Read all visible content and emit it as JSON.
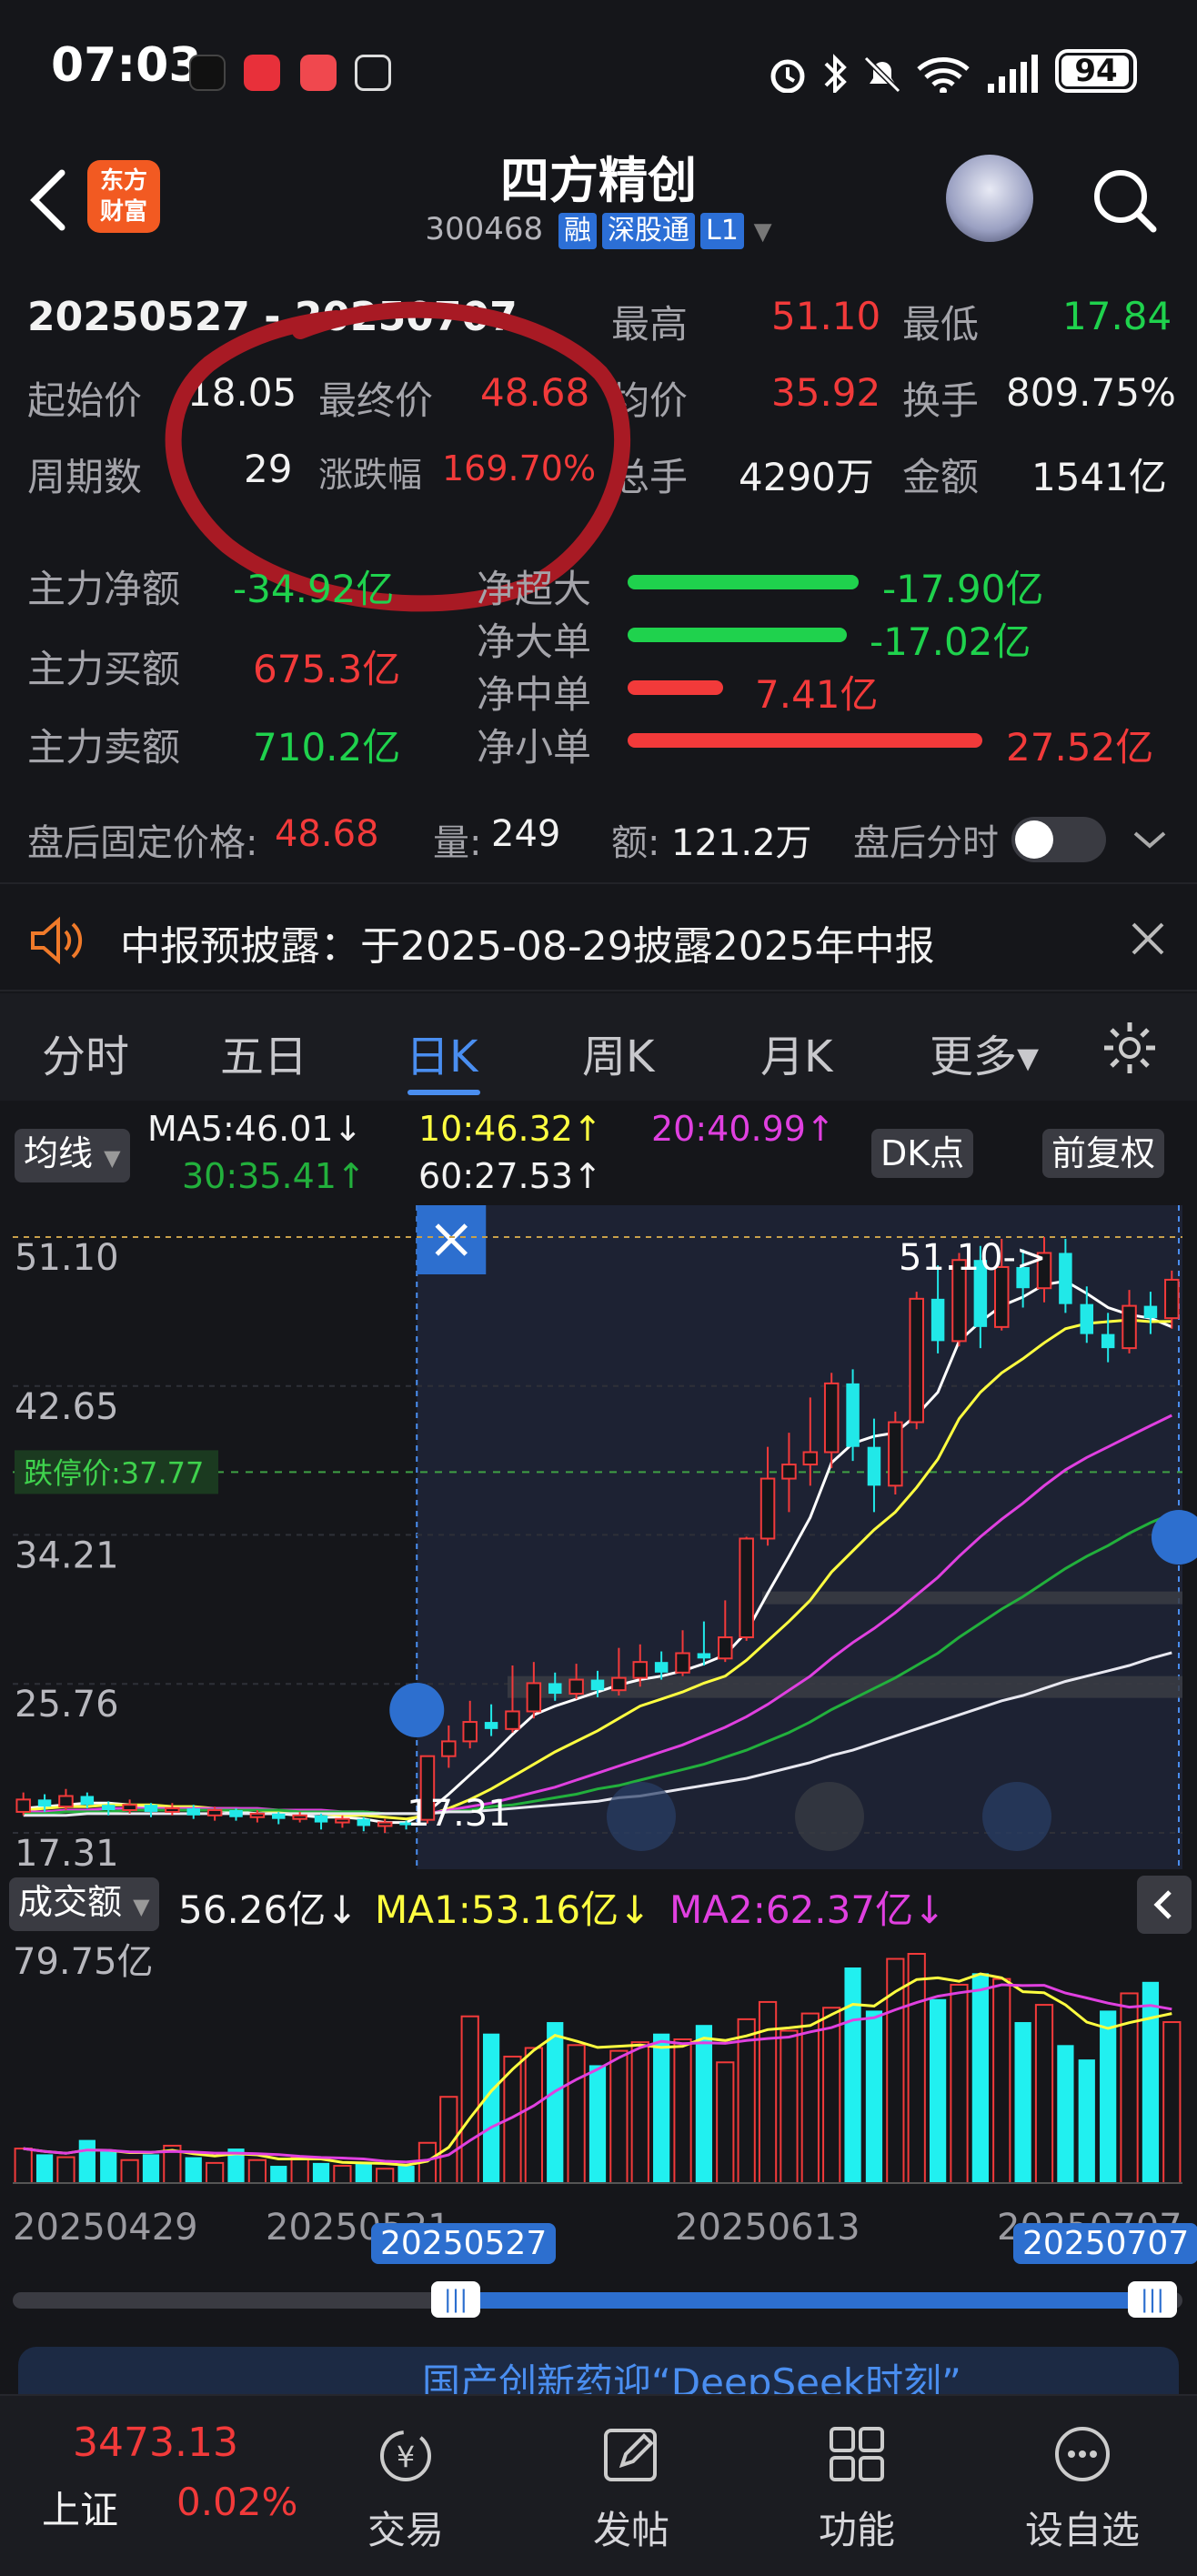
{
  "status_bar": {
    "time": "07:03",
    "battery": "94"
  },
  "header": {
    "logo_text": "东方财富",
    "stock_name": "四方精创",
    "stock_code": "300468",
    "tags": [
      "融",
      "深股通",
      "L1"
    ]
  },
  "summary": {
    "date_range": "20250527 - 20250707",
    "high_label": "最高",
    "high_value": "51.10",
    "low_label": "最低",
    "low_value": "17.84",
    "start_label": "起始价",
    "start_value": "18.05",
    "final_label": "最终价",
    "final_value": "48.68",
    "avg_label": "均价",
    "avg_value": "35.92",
    "turnover_label": "换手",
    "turnover_value": "809.75%",
    "period_label": "周期数",
    "period_value": "29",
    "change_label": "涨跌幅",
    "change_value": "169.70%",
    "volume_label": "总手",
    "volume_value": "4290万",
    "amount_label": "金额",
    "amount_value": "1541亿"
  },
  "funds": {
    "net_label": "主力净额",
    "net_value": "-34.92亿",
    "buy_label": "主力买额",
    "buy_value": "675.3亿",
    "sell_label": "主力卖额",
    "sell_value": "710.2亿",
    "bars": [
      {
        "label": "净超大",
        "value": "-17.90亿",
        "color": "#1fd24d",
        "magnitude": 17.9
      },
      {
        "label": "净大单",
        "value": "-17.02亿",
        "color": "#1fd24d",
        "magnitude": 17.02
      },
      {
        "label": "净中单",
        "value": "7.41亿",
        "color": "#f23a3a",
        "magnitude": 7.41
      },
      {
        "label": "净小单",
        "value": "27.52亿",
        "color": "#f23a3a",
        "magnitude": 27.52
      }
    ]
  },
  "after_hours": {
    "price_label": "盘后固定价格:",
    "price_value": "48.68",
    "vol_label": "量:",
    "vol_value": "249",
    "amt_label": "额:",
    "amt_value": "121.2万",
    "timeshare_label": "盘后分时"
  },
  "notice": {
    "text": "中报预披露：于2025-08-29披露2025年中报"
  },
  "tabs": [
    {
      "label": "分时"
    },
    {
      "label": "五日"
    },
    {
      "label": "日K"
    },
    {
      "label": "周K"
    },
    {
      "label": "月K"
    },
    {
      "label": "更多▾"
    }
  ],
  "indicators": {
    "ma_button": "均线",
    "ma5": "MA5:46.01↓",
    "ma10": "10:46.32↑",
    "ma20": "20:40.99↑",
    "ma30": "30:35.41↑",
    "ma60": "60:27.53↑",
    "dk_button": "DK点",
    "adjust_button": "前复权"
  },
  "chart_data": [
    {
      "type": "candlestick",
      "y_ticks": [
        "51.10",
        "42.65",
        "34.21",
        "25.76",
        "17.31"
      ],
      "limit_label": "跌停价:37.77",
      "limit_value": 37.77,
      "high_marker": "51.10->",
      "low_marker": "17.31",
      "ylim": [
        17.31,
        51.1
      ],
      "selection_start_index": 19,
      "candles": [
        {
          "o": 18.5,
          "c": 19.2,
          "h": 19.6,
          "l": 18.3
        },
        {
          "o": 19.2,
          "c": 18.8,
          "h": 19.5,
          "l": 18.5
        },
        {
          "o": 18.8,
          "c": 19.4,
          "h": 19.8,
          "l": 18.6
        },
        {
          "o": 19.4,
          "c": 18.9,
          "h": 19.6,
          "l": 18.7
        },
        {
          "o": 18.9,
          "c": 18.6,
          "h": 19.1,
          "l": 18.3
        },
        {
          "o": 18.6,
          "c": 18.9,
          "h": 19.2,
          "l": 18.4
        },
        {
          "o": 18.9,
          "c": 18.5,
          "h": 19.0,
          "l": 18.2
        },
        {
          "o": 18.5,
          "c": 18.7,
          "h": 19.0,
          "l": 18.3
        },
        {
          "o": 18.7,
          "c": 18.3,
          "h": 18.9,
          "l": 18.1
        },
        {
          "o": 18.3,
          "c": 18.6,
          "h": 18.8,
          "l": 18.0
        },
        {
          "o": 18.6,
          "c": 18.2,
          "h": 18.7,
          "l": 18.0
        },
        {
          "o": 18.2,
          "c": 18.4,
          "h": 18.6,
          "l": 17.9
        },
        {
          "o": 18.4,
          "c": 18.1,
          "h": 18.5,
          "l": 17.8
        },
        {
          "o": 18.1,
          "c": 18.3,
          "h": 18.5,
          "l": 17.9
        },
        {
          "o": 18.3,
          "c": 17.9,
          "h": 18.4,
          "l": 17.5
        },
        {
          "o": 17.9,
          "c": 18.1,
          "h": 18.3,
          "l": 17.6
        },
        {
          "o": 18.1,
          "c": 17.7,
          "h": 18.2,
          "l": 17.4
        },
        {
          "o": 17.7,
          "c": 17.9,
          "h": 18.1,
          "l": 17.31
        },
        {
          "o": 17.9,
          "c": 17.8,
          "h": 18.0,
          "l": 17.5
        },
        {
          "o": 18.05,
          "c": 21.66,
          "h": 21.66,
          "l": 17.84
        },
        {
          "o": 21.66,
          "c": 22.5,
          "h": 23.4,
          "l": 21.0
        },
        {
          "o": 22.5,
          "c": 23.6,
          "h": 24.8,
          "l": 22.1
        },
        {
          "o": 23.6,
          "c": 23.2,
          "h": 24.6,
          "l": 22.8
        },
        {
          "o": 23.2,
          "c": 24.2,
          "h": 26.8,
          "l": 23.0
        },
        {
          "o": 24.2,
          "c": 25.8,
          "h": 27.0,
          "l": 23.8
        },
        {
          "o": 25.8,
          "c": 25.2,
          "h": 26.4,
          "l": 24.8
        },
        {
          "o": 25.2,
          "c": 26.0,
          "h": 26.9,
          "l": 24.9
        },
        {
          "o": 26.0,
          "c": 25.4,
          "h": 26.5,
          "l": 25.0
        },
        {
          "o": 25.4,
          "c": 26.1,
          "h": 27.8,
          "l": 25.1
        },
        {
          "o": 26.1,
          "c": 27.0,
          "h": 28.0,
          "l": 25.6
        },
        {
          "o": 27.0,
          "c": 26.4,
          "h": 27.6,
          "l": 26.0
        },
        {
          "o": 26.4,
          "c": 27.5,
          "h": 28.8,
          "l": 26.2
        },
        {
          "o": 27.5,
          "c": 27.2,
          "h": 29.3,
          "l": 26.8
        },
        {
          "o": 27.2,
          "c": 28.4,
          "h": 30.5,
          "l": 27.0
        },
        {
          "o": 28.4,
          "c": 34.0,
          "h": 34.1,
          "l": 28.2
        },
        {
          "o": 34.0,
          "c": 37.4,
          "h": 39.2,
          "l": 33.6
        },
        {
          "o": 37.4,
          "c": 38.2,
          "h": 40.0,
          "l": 35.5
        },
        {
          "o": 38.2,
          "c": 38.9,
          "h": 42.0,
          "l": 37.0
        },
        {
          "o": 38.9,
          "c": 42.8,
          "h": 43.4,
          "l": 38.0
        },
        {
          "o": 42.8,
          "c": 39.2,
          "h": 43.6,
          "l": 38.4
        },
        {
          "o": 39.2,
          "c": 37.0,
          "h": 40.8,
          "l": 35.5
        },
        {
          "o": 37.0,
          "c": 40.6,
          "h": 41.2,
          "l": 36.5
        },
        {
          "o": 40.6,
          "c": 47.6,
          "h": 48.0,
          "l": 40.2
        },
        {
          "o": 47.6,
          "c": 45.2,
          "h": 49.5,
          "l": 44.5
        },
        {
          "o": 45.2,
          "c": 49.8,
          "h": 50.2,
          "l": 44.9
        },
        {
          "o": 49.8,
          "c": 46.0,
          "h": 50.6,
          "l": 44.8
        },
        {
          "o": 46.0,
          "c": 49.4,
          "h": 51.0,
          "l": 45.8
        },
        {
          "o": 49.4,
          "c": 48.2,
          "h": 50.4,
          "l": 47.1
        },
        {
          "o": 48.2,
          "c": 50.2,
          "h": 51.1,
          "l": 47.4
        },
        {
          "o": 50.2,
          "c": 47.3,
          "h": 51.0,
          "l": 46.8
        },
        {
          "o": 47.3,
          "c": 45.6,
          "h": 48.3,
          "l": 45.1
        },
        {
          "o": 45.6,
          "c": 44.8,
          "h": 46.8,
          "l": 44.0
        },
        {
          "o": 44.8,
          "c": 47.2,
          "h": 48.1,
          "l": 44.5
        },
        {
          "o": 47.2,
          "c": 46.5,
          "h": 48.0,
          "l": 45.6
        },
        {
          "o": 46.5,
          "c": 48.68,
          "h": 49.2,
          "l": 45.9
        }
      ],
      "ma_lines": [
        {
          "name": "MA5",
          "color": "#ffffff",
          "values": [
            18.7,
            18.8,
            18.9,
            19.0,
            19.0,
            18.9,
            18.8,
            18.7,
            18.6,
            18.6,
            18.5,
            18.4,
            18.4,
            18.3,
            18.2,
            18.2,
            18.1,
            17.9,
            17.9,
            18.5,
            19.5,
            20.6,
            21.7,
            22.9,
            24.0,
            24.5,
            24.9,
            25.3,
            25.7,
            26.0,
            26.2,
            26.5,
            26.9,
            27.4,
            28.7,
            30.9,
            33.0,
            35.2,
            38.3,
            39.4,
            39.8,
            40.0,
            41.0,
            42.3,
            45.2,
            46.3,
            47.2,
            47.7,
            48.4,
            48.6,
            47.9,
            47.1,
            46.7,
            46.5,
            46.01
          ]
        },
        {
          "name": "MA10",
          "color": "#ffff40",
          "values": [
            18.6,
            18.7,
            18.8,
            18.8,
            18.9,
            18.9,
            18.9,
            18.8,
            18.8,
            18.7,
            18.7,
            18.6,
            18.5,
            18.5,
            18.4,
            18.3,
            18.3,
            18.2,
            18.1,
            18.3,
            18.7,
            19.2,
            19.8,
            20.5,
            21.2,
            21.9,
            22.5,
            23.1,
            23.8,
            24.5,
            24.9,
            25.3,
            25.8,
            26.2,
            27.1,
            28.2,
            29.3,
            30.5,
            32.1,
            33.3,
            34.5,
            35.5,
            36.9,
            38.5,
            40.8,
            42.3,
            43.4,
            44.2,
            45.1,
            45.9,
            46.2,
            46.3,
            46.4,
            46.3,
            46.32
          ]
        },
        {
          "name": "MA20",
          "color": "#e040e0",
          "values": [
            18.5,
            18.5,
            18.6,
            18.6,
            18.7,
            18.7,
            18.7,
            18.7,
            18.7,
            18.7,
            18.7,
            18.7,
            18.6,
            18.6,
            18.6,
            18.5,
            18.5,
            18.4,
            18.4,
            18.4,
            18.6,
            18.8,
            19.0,
            19.3,
            19.6,
            19.9,
            20.3,
            20.7,
            21.1,
            21.5,
            21.9,
            22.3,
            22.8,
            23.3,
            23.9,
            24.6,
            25.4,
            26.2,
            27.2,
            28.1,
            28.9,
            29.8,
            30.8,
            31.8,
            33.0,
            34.1,
            35.1,
            36.0,
            37.0,
            37.9,
            38.6,
            39.2,
            39.8,
            40.4,
            40.99
          ]
        },
        {
          "name": "MA30",
          "color": "#22b03c",
          "values": [
            18.4,
            18.4,
            18.5,
            18.5,
            18.5,
            18.6,
            18.6,
            18.6,
            18.6,
            18.6,
            18.6,
            18.6,
            18.6,
            18.5,
            18.5,
            18.5,
            18.5,
            18.4,
            18.4,
            18.4,
            18.5,
            18.6,
            18.8,
            18.9,
            19.1,
            19.3,
            19.5,
            19.8,
            20.0,
            20.3,
            20.6,
            20.9,
            21.2,
            21.6,
            22.0,
            22.5,
            23.0,
            23.6,
            24.3,
            24.9,
            25.5,
            26.1,
            26.8,
            27.5,
            28.4,
            29.2,
            30.0,
            30.7,
            31.5,
            32.3,
            33.0,
            33.6,
            34.3,
            34.9,
            35.41
          ]
        },
        {
          "name": "MA60",
          "color": "#e8e8f0",
          "values": [
            18.3,
            18.3,
            18.3,
            18.4,
            18.4,
            18.4,
            18.4,
            18.4,
            18.4,
            18.4,
            18.4,
            18.4,
            18.4,
            18.4,
            18.4,
            18.4,
            18.4,
            18.4,
            18.4,
            18.4,
            18.5,
            18.5,
            18.6,
            18.7,
            18.8,
            18.9,
            19.0,
            19.1,
            19.3,
            19.4,
            19.6,
            19.8,
            20.0,
            20.2,
            20.4,
            20.7,
            21.0,
            21.3,
            21.7,
            22.0,
            22.4,
            22.8,
            23.2,
            23.6,
            24.0,
            24.4,
            24.8,
            25.1,
            25.5,
            25.9,
            26.2,
            26.5,
            26.8,
            27.2,
            27.53
          ]
        }
      ]
    },
    {
      "type": "bar",
      "name_label": "成交额",
      "current": "56.26亿↓",
      "ma1": "MA1:53.16亿↓",
      "ma2": "MA2:62.37亿↓",
      "y_max_label": "79.75亿",
      "ylim": [
        0,
        79.75
      ],
      "x_labels": [
        "20250429",
        "20250521",
        "20250613",
        "20250707"
      ],
      "selection_start_label": "20250527",
      "selection_end_label": "20250707",
      "values": [
        12,
        10,
        9,
        15,
        11,
        8,
        10,
        13,
        9,
        7,
        12,
        8,
        6,
        9,
        7,
        6,
        7,
        5,
        6,
        14,
        30,
        58,
        52,
        44,
        47,
        56,
        48,
        41,
        46,
        49,
        52,
        50,
        55,
        42,
        57,
        63,
        53,
        59,
        61,
        75,
        60,
        78,
        80,
        64,
        69,
        73,
        71,
        56,
        62,
        48,
        43,
        60,
        66,
        70,
        56
      ]
    }
  ],
  "banner_text": "国产创新药迎“DeepSeek时刻”",
  "bottom_nav": {
    "index_value": "3473.13",
    "index_label": "上证",
    "index_change": "0.02%",
    "items": [
      {
        "label": "交易",
        "icon": "yen-exchange-icon"
      },
      {
        "label": "发帖",
        "icon": "edit-icon"
      },
      {
        "label": "功能",
        "icon": "grid-icon"
      },
      {
        "label": "设自选",
        "icon": "more-icon"
      }
    ]
  }
}
